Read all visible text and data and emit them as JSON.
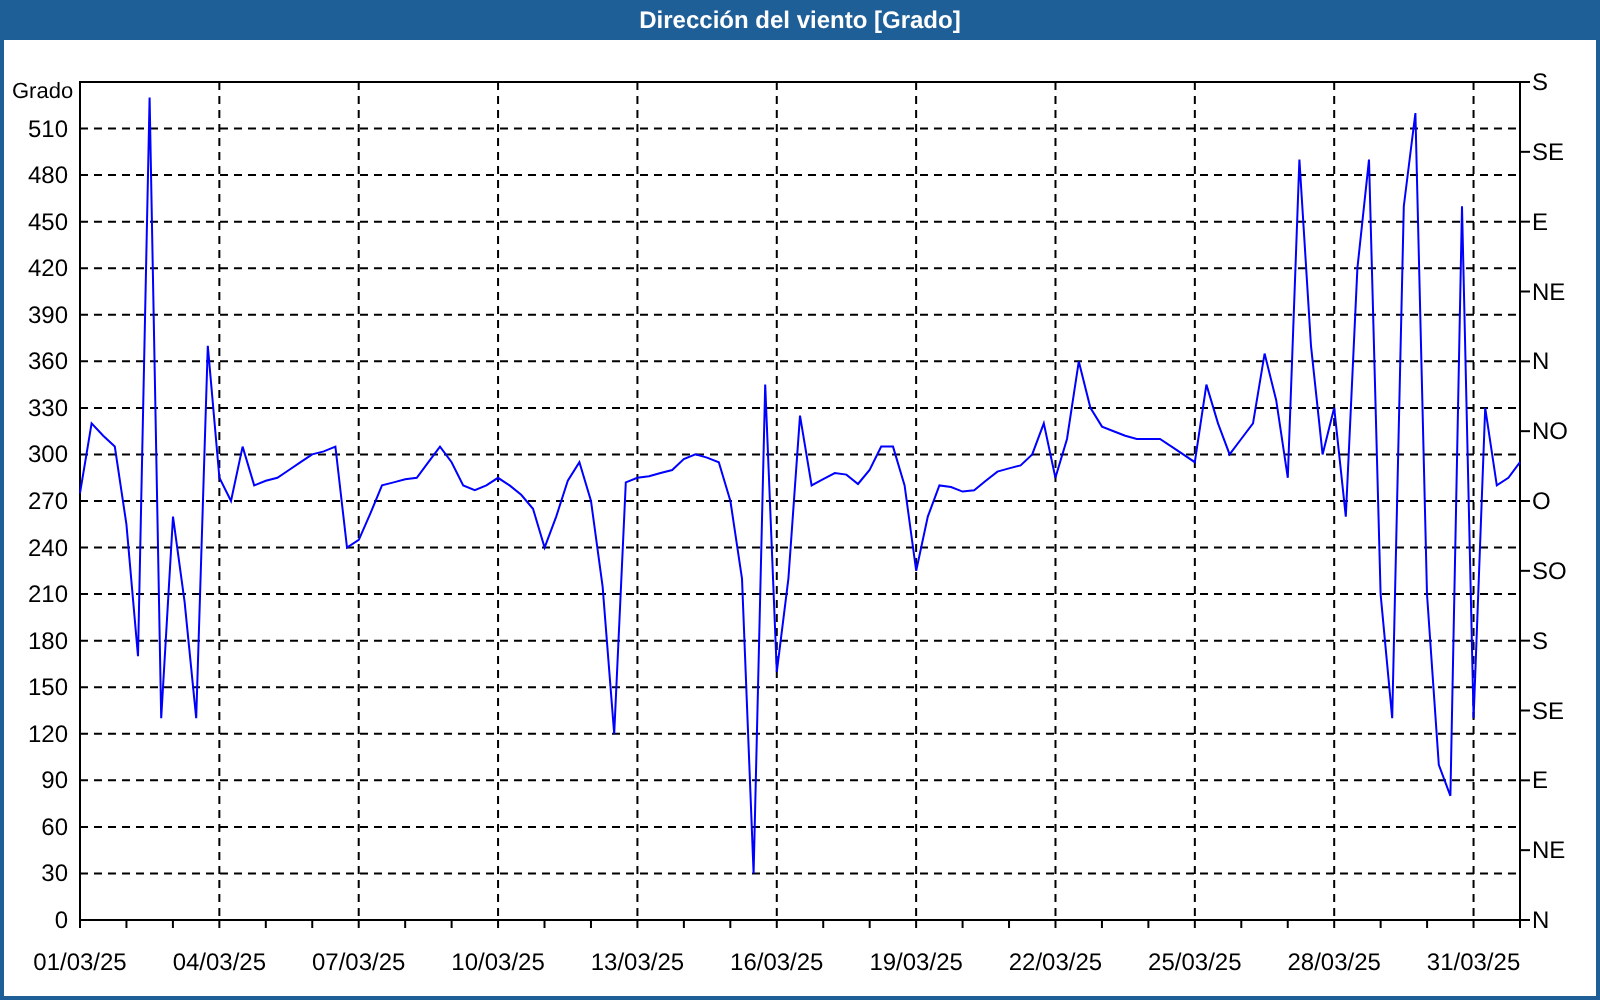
{
  "window": {
    "title": "Dirección del viento [Grado]"
  },
  "chart": {
    "right_axis_labels": [
      "S",
      "SE",
      "E",
      "NE",
      "N",
      "NO",
      "O",
      "SO",
      "S",
      "SE",
      "E",
      "NE",
      "N"
    ],
    "chart_data": {
      "type": "line",
      "grid": true,
      "ylabel": "Grado",
      "ylim": [
        0,
        540
      ],
      "yticks": [
        0,
        30,
        60,
        90,
        120,
        150,
        180,
        210,
        240,
        270,
        300,
        330,
        360,
        390,
        420,
        450,
        480,
        510
      ],
      "categories": [
        "01/03/25",
        null,
        null,
        null,
        null,
        null,
        null,
        null,
        null,
        null,
        null,
        null,
        "04/03/25",
        null,
        null,
        null,
        null,
        null,
        null,
        null,
        null,
        null,
        null,
        null,
        "07/03/25",
        null,
        null,
        null,
        null,
        null,
        null,
        null,
        null,
        null,
        null,
        null,
        "10/03/25",
        null,
        null,
        null,
        null,
        null,
        null,
        null,
        null,
        null,
        null,
        null,
        "13/03/25",
        null,
        null,
        null,
        null,
        null,
        null,
        null,
        null,
        null,
        null,
        null,
        "16/03/25",
        null,
        null,
        null,
        null,
        null,
        null,
        null,
        null,
        null,
        null,
        null,
        "19/03/25",
        null,
        null,
        null,
        null,
        null,
        null,
        null,
        null,
        null,
        null,
        null,
        "22/03/25",
        null,
        null,
        null,
        null,
        null,
        null,
        null,
        null,
        null,
        null,
        null,
        "25/03/25",
        null,
        null,
        null,
        null,
        null,
        null,
        null,
        null,
        null,
        null,
        null,
        "28/03/25",
        null,
        null,
        null,
        null,
        null,
        null,
        null,
        null,
        null,
        null,
        null,
        "31/03/25",
        null,
        null,
        null,
        null
      ],
      "series": [
        {
          "color": "#0000ff",
          "values": [
            275,
            320,
            312,
            305,
            255,
            170,
            530,
            130,
            260,
            205,
            130,
            370,
            285,
            270,
            305,
            280,
            283,
            285,
            290,
            295,
            300,
            302,
            305,
            240,
            245,
            262,
            280,
            282,
            284,
            285,
            295,
            305,
            295,
            280,
            277,
            280,
            285,
            280,
            274,
            265,
            240,
            260,
            283,
            295,
            270,
            215,
            120,
            282,
            285,
            286,
            288,
            290,
            297,
            300,
            298,
            295,
            270,
            220,
            30,
            345,
            160,
            220,
            325,
            280,
            284,
            288,
            287,
            281,
            290,
            305,
            305,
            280,
            225,
            260,
            280,
            279,
            276,
            277,
            283,
            289,
            291,
            293,
            300,
            320,
            285,
            310,
            360,
            330,
            318,
            315,
            312,
            310,
            310,
            310,
            305,
            300,
            295,
            345,
            320,
            300,
            310,
            320,
            365,
            335,
            285,
            490,
            370,
            300,
            330,
            260,
            420,
            490,
            210,
            130,
            460,
            520,
            210,
            100,
            80,
            460,
            130,
            330,
            280,
            285,
            295
          ]
        }
      ]
    }
  }
}
